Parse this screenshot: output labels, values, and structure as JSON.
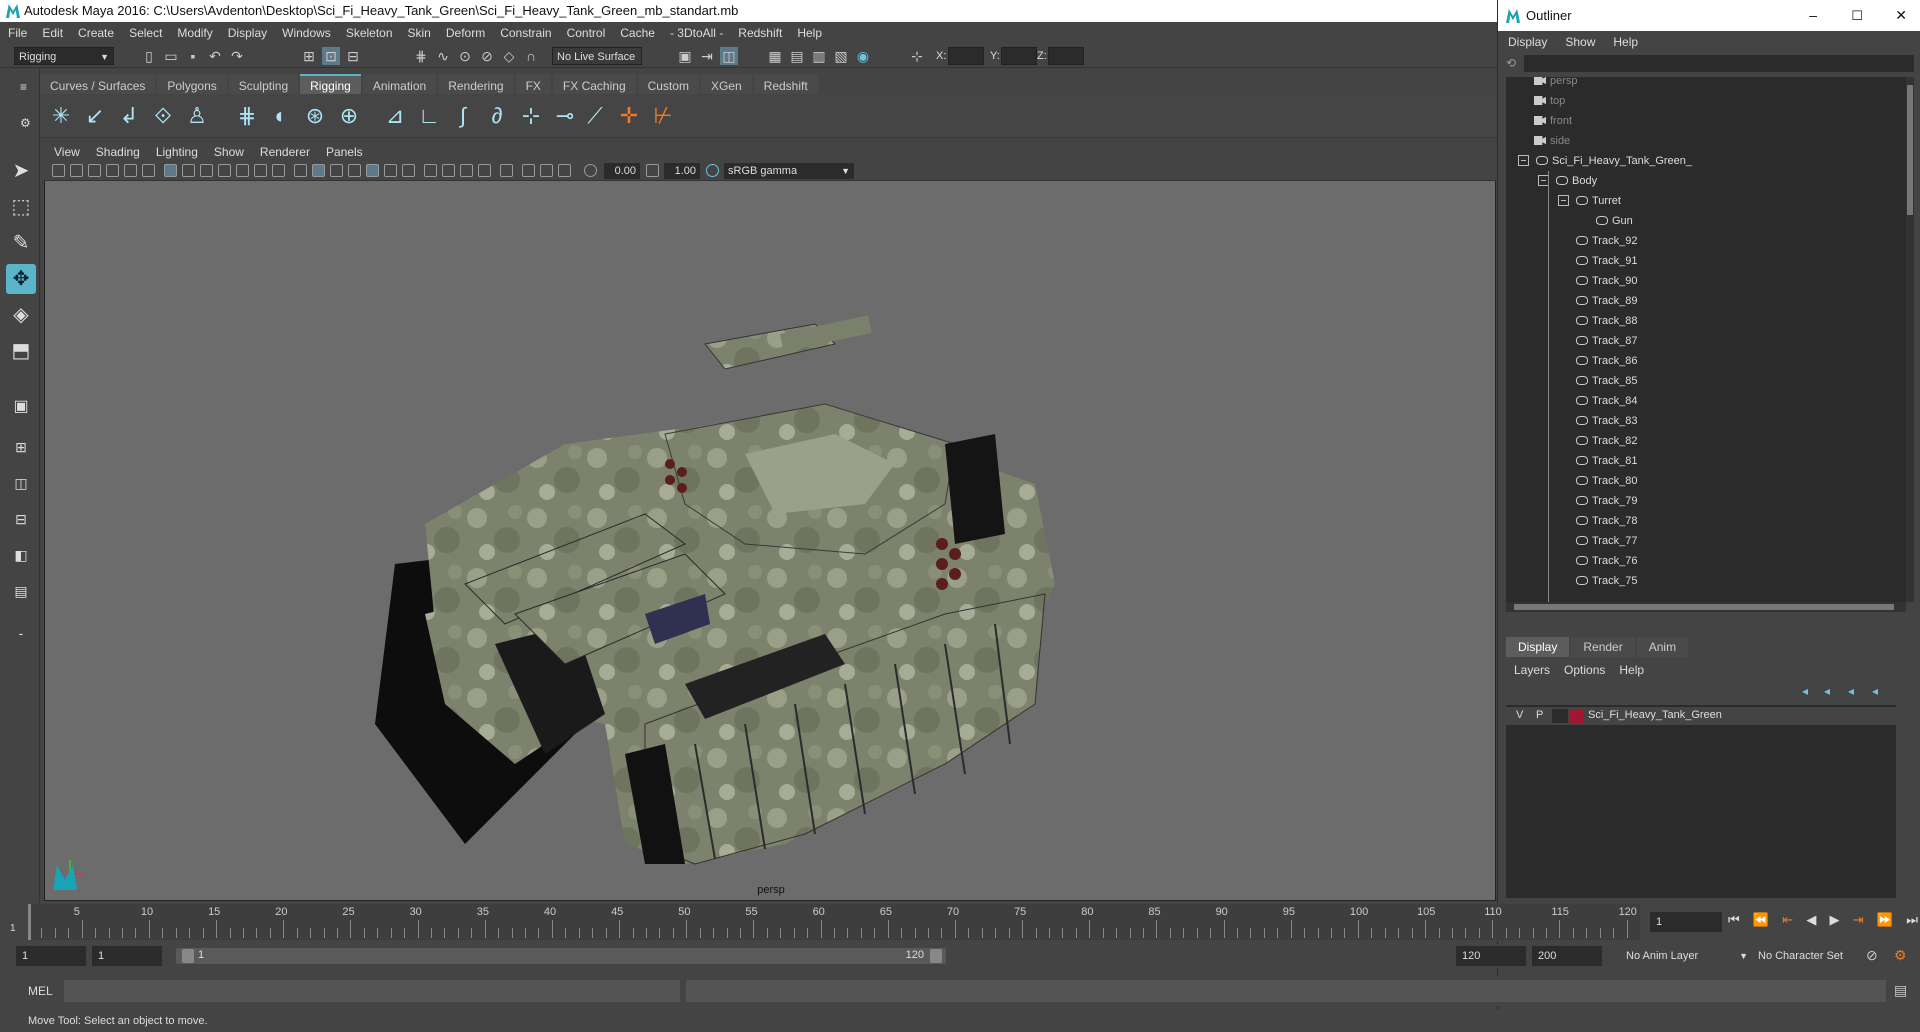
{
  "window": {
    "title": "Autodesk Maya 2016: C:\\Users\\Avdenton\\Desktop\\Sci_Fi_Heavy_Tank_Green\\Sci_Fi_Heavy_Tank_Green_mb_standart.mb"
  },
  "menubar": [
    "File",
    "Edit",
    "Create",
    "Select",
    "Modify",
    "Display",
    "Windows",
    "Skeleton",
    "Skin",
    "Deform",
    "Constrain",
    "Control",
    "Cache",
    "- 3DtoAll -",
    "Redshift",
    "Help"
  ],
  "statusline": {
    "mode": "Rigging",
    "live_surface": "No Live Surface",
    "x_label": "X:",
    "y_label": "Y:",
    "z_label": "Z:"
  },
  "shelf_tabs": [
    "Curves / Surfaces",
    "Polygons",
    "Sculpting",
    "Rigging",
    "Animation",
    "Rendering",
    "FX",
    "FX Caching",
    "Custom",
    "XGen",
    "Redshift"
  ],
  "shelf_active": "Rigging",
  "viewport": {
    "menu": [
      "View",
      "Shading",
      "Lighting",
      "Show",
      "Renderer",
      "Panels"
    ],
    "exposure": "0.00",
    "gamma": "1.00",
    "color_space": "sRGB gamma",
    "camera": "persp"
  },
  "outliner": {
    "title": "Outliner",
    "menu": [
      "Display",
      "Show",
      "Help"
    ],
    "cameras": [
      "persp",
      "top",
      "front",
      "side"
    ],
    "root": "Sci_Fi_Heavy_Tank_Green_",
    "body": "Body",
    "turret": "Turret",
    "gun": "Gun",
    "tracks": [
      "Track_92",
      "Track_91",
      "Track_90",
      "Track_89",
      "Track_88",
      "Track_87",
      "Track_86",
      "Track_85",
      "Track_84",
      "Track_83",
      "Track_82",
      "Track_81",
      "Track_80",
      "Track_79",
      "Track_78",
      "Track_77",
      "Track_76",
      "Track_75"
    ]
  },
  "layers": {
    "tabs": [
      "Display",
      "Render",
      "Anim"
    ],
    "active_tab": "Display",
    "menu": [
      "Layers",
      "Options",
      "Help"
    ],
    "row": {
      "v": "V",
      "p": "P",
      "name": "Sci_Fi_Heavy_Tank_Green",
      "color": "#a0172f"
    }
  },
  "timeline": {
    "ticks": [
      "5",
      "10",
      "15",
      "20",
      "25",
      "30",
      "35",
      "40",
      "45",
      "50",
      "55",
      "60",
      "65",
      "70",
      "75",
      "80",
      "85",
      "90",
      "95",
      "100",
      "105",
      "110",
      "115",
      "120"
    ],
    "start_marker": "1",
    "current_frame": "1"
  },
  "range": {
    "start": "1",
    "anim_start": "1",
    "range_start": "1",
    "range_end": "120",
    "anim_end": "120",
    "end": "200",
    "anim_layer": "No Anim Layer",
    "char_set": "No Character Set"
  },
  "cmdline": {
    "label": "MEL"
  },
  "help_line": "Move Tool: Select an object to move.",
  "colors": {
    "accent": "#5ab5c8",
    "bg": "#444444",
    "viewport": "#6c6c6c"
  }
}
